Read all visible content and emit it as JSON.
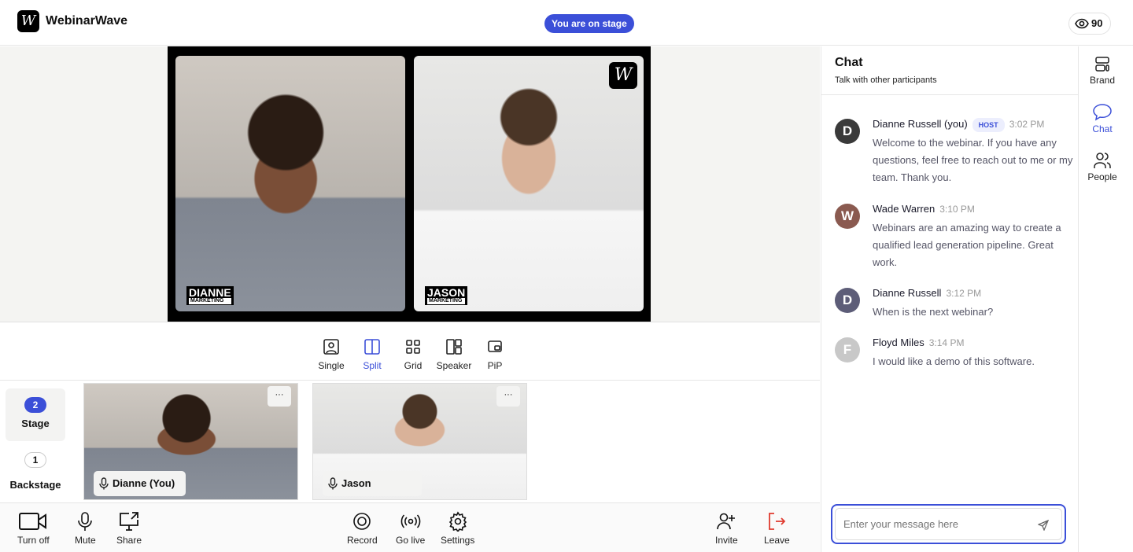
{
  "header": {
    "brand": "WebinarWave",
    "logo_letter": "W",
    "stage_badge": "You are on stage",
    "viewer_count": "90"
  },
  "stage": {
    "participants": [
      {
        "name": "DIANNE",
        "role": "MARKETING"
      },
      {
        "name": "JASON",
        "role": "MARKETING"
      }
    ],
    "watermark": "W"
  },
  "layouts": [
    {
      "label": "Single",
      "icon": "single-icon"
    },
    {
      "label": "Split",
      "icon": "split-icon",
      "active": true
    },
    {
      "label": "Grid",
      "icon": "grid-icon"
    },
    {
      "label": "Speaker",
      "icon": "speaker-icon"
    },
    {
      "label": "PiP",
      "icon": "pip-icon"
    }
  ],
  "sections": {
    "stage_count": "2",
    "stage_label": "Stage",
    "backstage_count": "1",
    "backstage_label": "Backstage"
  },
  "thumbnails": [
    {
      "name": "Dianne (You)",
      "more": "···"
    },
    {
      "name": "Jason",
      "more": "···"
    }
  ],
  "toolbar": {
    "turn_off": "Turn off",
    "mute": "Mute",
    "share": "Share",
    "record": "Record",
    "go_live": "Go live",
    "settings": "Settings",
    "invite": "Invite",
    "leave": "Leave"
  },
  "chat": {
    "title": "Chat",
    "subtitle": "Talk with other participants",
    "placeholder": "Enter your message here",
    "messages": [
      {
        "initial": "D",
        "author": "Dianne Russell (you)",
        "badge": "HOST",
        "time": "3:02 PM",
        "text": "Welcome to the webinar. If you have any questions, feel free to reach out to me or my team. Thank you.",
        "color": "#3a3a3a"
      },
      {
        "initial": "W",
        "author": "Wade Warren",
        "time": "3:10 PM",
        "text": "Webinars are an amazing way to create a qualified lead generation pipeline. Great work.",
        "color": "#8a5a50"
      },
      {
        "initial": "D",
        "author": "Dianne Russell",
        "time": "3:12 PM",
        "text": "When is the next webinar?",
        "color": "#5d5d78"
      },
      {
        "initial": "F",
        "author": "Floyd Miles",
        "time": "3:14 PM",
        "text": "I would like a demo of this software.",
        "color": "#c8c8c8"
      }
    ]
  },
  "rail": {
    "brand": "Brand",
    "chat": "Chat",
    "people": "People"
  },
  "colors": {
    "accent": "#3b4fd8",
    "leave": "#e03b2f"
  }
}
